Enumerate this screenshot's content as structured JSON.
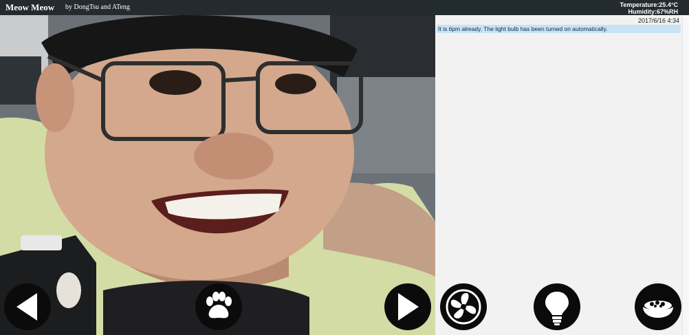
{
  "header": {
    "title": "Meow Meow",
    "byline": "by DongTsu and ATeng",
    "temperature": "Temperature:25.4°C",
    "humidity": "Humidity:67%RH"
  },
  "log": {
    "entries": [
      {
        "time": "2017/6/16 4:34",
        "message": "It is 6pm already. The light bulb has been turned on automatically."
      }
    ]
  },
  "controls": {
    "left": "left-arrow-icon",
    "paw": "paw-icon",
    "right": "right-arrow-icon",
    "fan": "fan-icon",
    "bulb": "light-bulb-icon",
    "food": "food-bowl-icon"
  },
  "colors": {
    "header_bg": "#232b2f",
    "log_highlight": "#c7e3f5",
    "control_bg": "#0b0b0b"
  }
}
